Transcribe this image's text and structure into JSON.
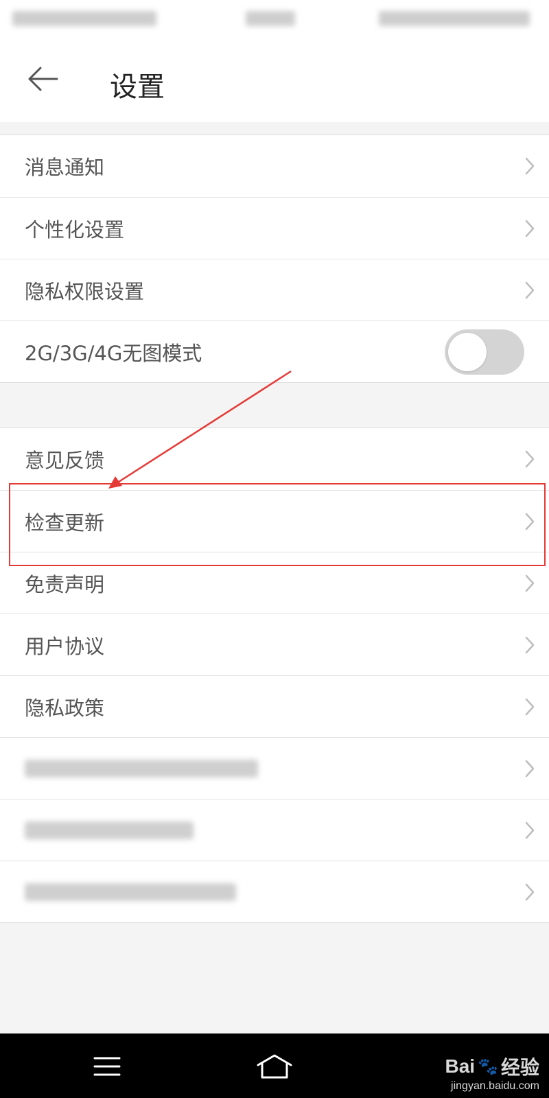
{
  "header": {
    "title": "设置"
  },
  "settings_group_1": [
    {
      "label": "消息通知"
    },
    {
      "label": "个性化设置"
    },
    {
      "label": "隐私权限设置"
    }
  ],
  "no_image_mode": {
    "label": "2G/3G/4G无图模式",
    "enabled": false
  },
  "settings_group_2": [
    {
      "label": "意见反馈"
    },
    {
      "label": "检查更新"
    },
    {
      "label": "免责声明"
    },
    {
      "label": "用户协议"
    },
    {
      "label": "隐私政策"
    }
  ],
  "watermark": {
    "brand_left": "Bai",
    "brand_right": "经验",
    "url": "jingyan.baidu.com"
  },
  "colors": {
    "annotation": "#e53935",
    "toggle_off": "#d4d4d4",
    "nav_bar": "#000000"
  },
  "icons": {
    "back": "back-arrow-icon",
    "chevron": "chevron-right-icon",
    "menu": "menu-icon",
    "home": "home-icon"
  }
}
